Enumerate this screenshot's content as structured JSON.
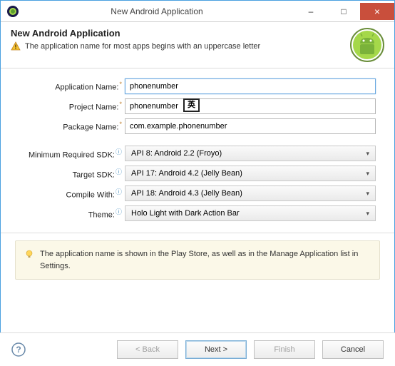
{
  "window": {
    "title": "New Android Application",
    "minimize": "–",
    "maximize": "□",
    "close": "×"
  },
  "header": {
    "title": "New Android Application",
    "warning": "The application name for most apps begins with an uppercase letter"
  },
  "form": {
    "app_name_label": "Application Name:",
    "app_name_value": "phonenumber",
    "project_name_label": "Project Name:",
    "project_name_value": "phonenumber",
    "package_name_label": "Package Name:",
    "package_name_value": "com.example.phonenumber",
    "min_sdk_label": "Minimum Required SDK:",
    "min_sdk_value": "API 8: Android 2.2 (Froyo)",
    "target_sdk_label": "Target SDK:",
    "target_sdk_value": "API 17: Android 4.2 (Jelly Bean)",
    "compile_label": "Compile With:",
    "compile_value": "API 18: Android 4.3 (Jelly Bean)",
    "theme_label": "Theme:",
    "theme_value": "Holo Light with Dark Action Bar",
    "ime_badge": "英"
  },
  "info": {
    "text": "The application name is shown in the Play Store, as well as in the Manage Application list in Settings."
  },
  "footer": {
    "back": "< Back",
    "next": "Next >",
    "finish": "Finish",
    "cancel": "Cancel"
  }
}
